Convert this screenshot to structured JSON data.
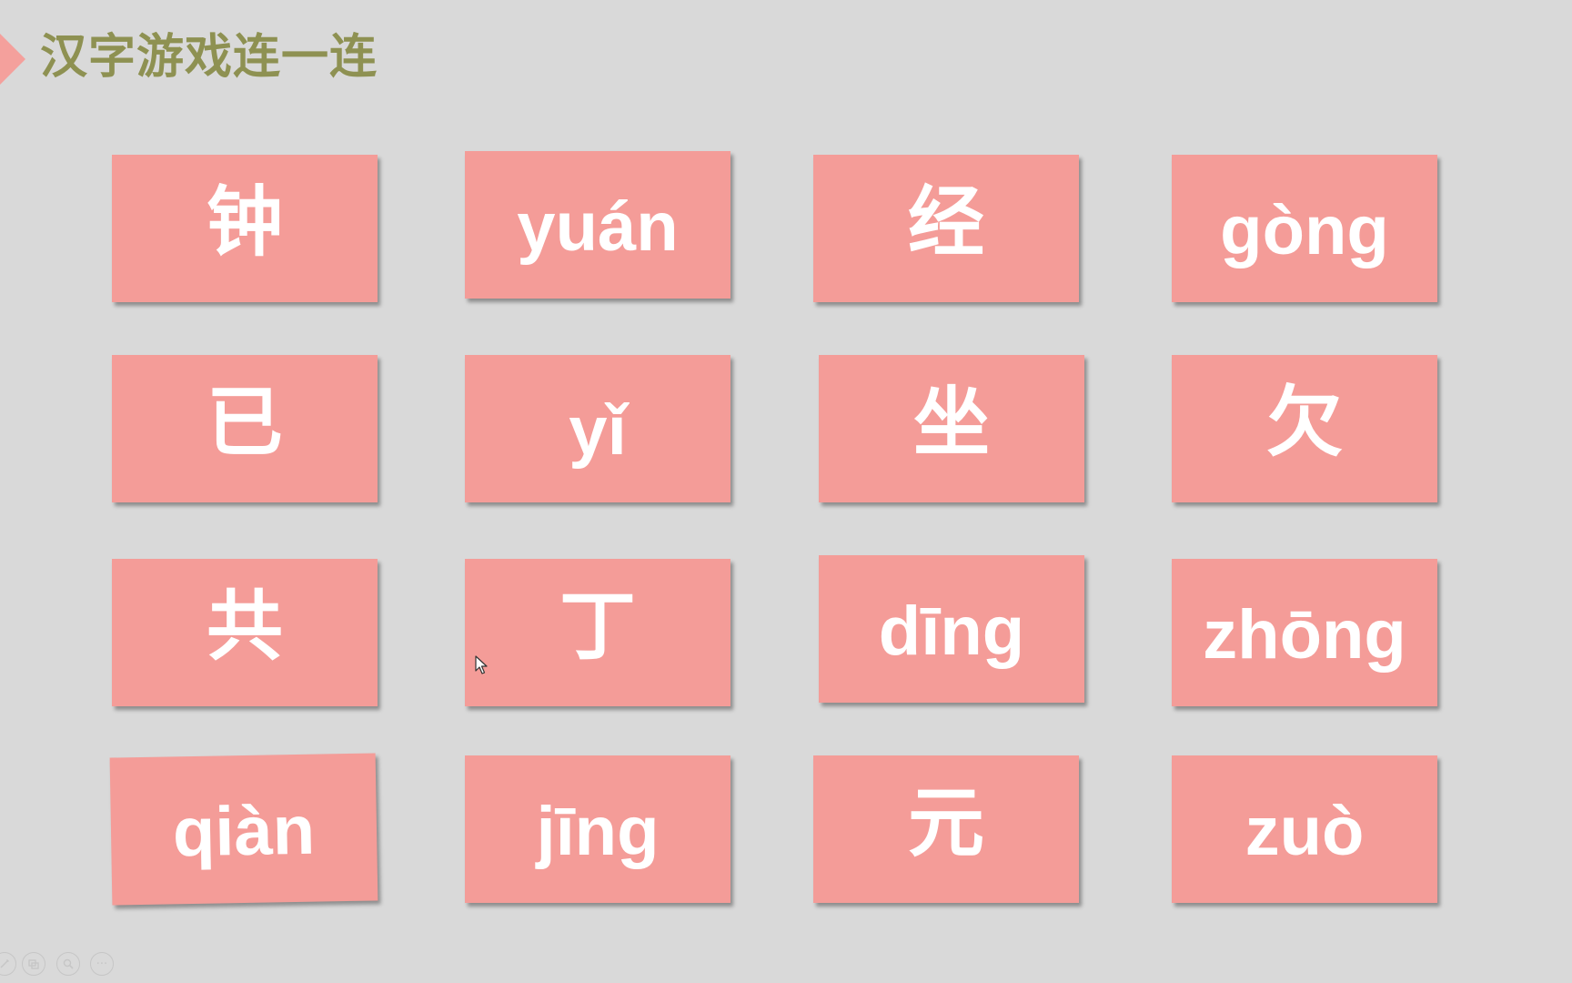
{
  "slide": {
    "title": "汉字游戏连一连",
    "accent_color": "#f49c98",
    "title_color": "#8e9152",
    "card_text_color": "#ffffff",
    "background_color": "#d9d9d9"
  },
  "cards": [
    {
      "text": "钟",
      "kind": "hanzi"
    },
    {
      "text": "yuán",
      "kind": "pinyin"
    },
    {
      "text": "经",
      "kind": "hanzi"
    },
    {
      "text": "gòng",
      "kind": "pinyin"
    },
    {
      "text": "已",
      "kind": "hanzi"
    },
    {
      "text": "yǐ",
      "kind": "pinyin"
    },
    {
      "text": "坐",
      "kind": "hanzi"
    },
    {
      "text": "欠",
      "kind": "hanzi"
    },
    {
      "text": "共",
      "kind": "hanzi"
    },
    {
      "text": "丁",
      "kind": "hanzi"
    },
    {
      "text": "dīng",
      "kind": "pinyin"
    },
    {
      "text": "zhōng",
      "kind": "pinyin"
    },
    {
      "text": "qiàn",
      "kind": "pinyin"
    },
    {
      "text": "jīng",
      "kind": "pinyin"
    },
    {
      "text": "元",
      "kind": "hanzi"
    },
    {
      "text": "zuò",
      "kind": "pinyin"
    }
  ],
  "toolbar": {
    "icons": [
      "pen-icon",
      "slides-icon",
      "zoom-icon",
      "more-icon"
    ],
    "more_label": "···"
  }
}
